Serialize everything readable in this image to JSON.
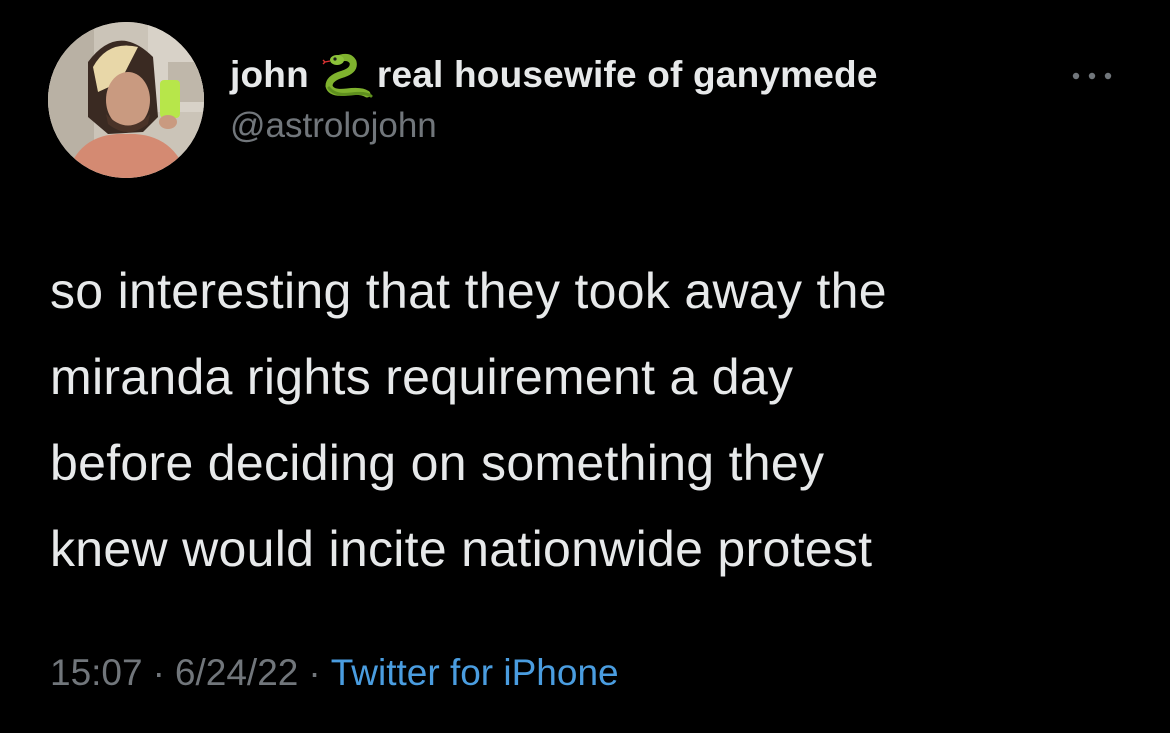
{
  "tweet": {
    "author": {
      "name": "john",
      "name_emoji_icon": "snake-icon",
      "name_suffix": "real housewife of ganymede",
      "handle": "@astrolojohn"
    },
    "more_icon": "ellipsis-icon",
    "text_lines": [
      "so interesting that they took away the",
      "miranda rights requirement a day",
      "before deciding on something they",
      "knew would incite nationwide protest"
    ],
    "meta": {
      "time": "15:07",
      "separator": "·",
      "date": "6/24/22",
      "source": "Twitter for iPhone"
    }
  },
  "colors": {
    "background": "#000000",
    "text": "#e7e9ea",
    "muted": "#71767b",
    "link": "#4a9de0"
  }
}
